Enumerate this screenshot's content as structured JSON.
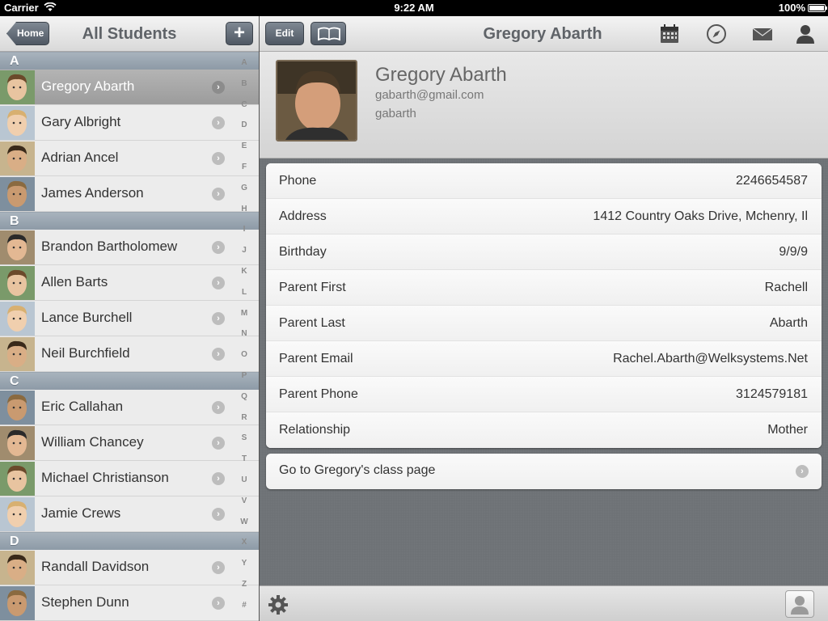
{
  "status_bar": {
    "carrier": "Carrier",
    "time": "9:22 AM",
    "battery": "100%"
  },
  "left_nav": {
    "back_label": "Home",
    "title": "All Students",
    "add_label": "+"
  },
  "sections": [
    {
      "letter": "A",
      "students": [
        {
          "name": "Gregory Abarth",
          "selected": true
        },
        {
          "name": "Gary Albright"
        },
        {
          "name": "Adrian Ancel"
        },
        {
          "name": "James Anderson"
        }
      ]
    },
    {
      "letter": "B",
      "students": [
        {
          "name": "Brandon Bartholomew"
        },
        {
          "name": "Allen Barts"
        },
        {
          "name": "Lance Burchell"
        },
        {
          "name": "Neil Burchfield"
        }
      ]
    },
    {
      "letter": "C",
      "students": [
        {
          "name": "Eric Callahan"
        },
        {
          "name": "William Chancey"
        },
        {
          "name": "Michael Christianson"
        },
        {
          "name": "Jamie Crews"
        }
      ]
    },
    {
      "letter": "D",
      "students": [
        {
          "name": "Randall Davidson"
        },
        {
          "name": "Stephen Dunn"
        }
      ]
    }
  ],
  "index_letters": [
    "A",
    "B",
    "C",
    "D",
    "E",
    "F",
    "G",
    "H",
    "I",
    "J",
    "K",
    "L",
    "M",
    "N",
    "O",
    "P",
    "Q",
    "R",
    "S",
    "T",
    "U",
    "V",
    "W",
    "X",
    "Y",
    "Z",
    "#"
  ],
  "right_nav": {
    "edit_label": "Edit",
    "title": "Gregory Abarth"
  },
  "profile": {
    "name": "Gregory Abarth",
    "email": "gabarth@gmail.com",
    "username": "gabarth"
  },
  "details": [
    {
      "label": "Phone",
      "value": "2246654587"
    },
    {
      "label": "Address",
      "value": "1412 Country Oaks Drive, Mchenry, Il"
    },
    {
      "label": "Birthday",
      "value": "9/9/9"
    },
    {
      "label": "Parent First",
      "value": "Rachell"
    },
    {
      "label": "Parent Last",
      "value": "Abarth"
    },
    {
      "label": "Parent Email",
      "value": "Rachel.Abarth@Welksystems.Net"
    },
    {
      "label": "Parent Phone",
      "value": "3124579181"
    },
    {
      "label": "Relationship",
      "value": "Mother"
    }
  ],
  "class_page": {
    "label": "Go to Gregory's class page"
  },
  "icons": [
    "calendar-icon",
    "compass-icon",
    "mail-icon",
    "person-icon",
    "book-icon",
    "gear-icon",
    "contact-icon"
  ],
  "colors": {
    "section_header": "#98a4af",
    "nav_button": "#5f6873",
    "selected_row": "#a8a8a8"
  }
}
